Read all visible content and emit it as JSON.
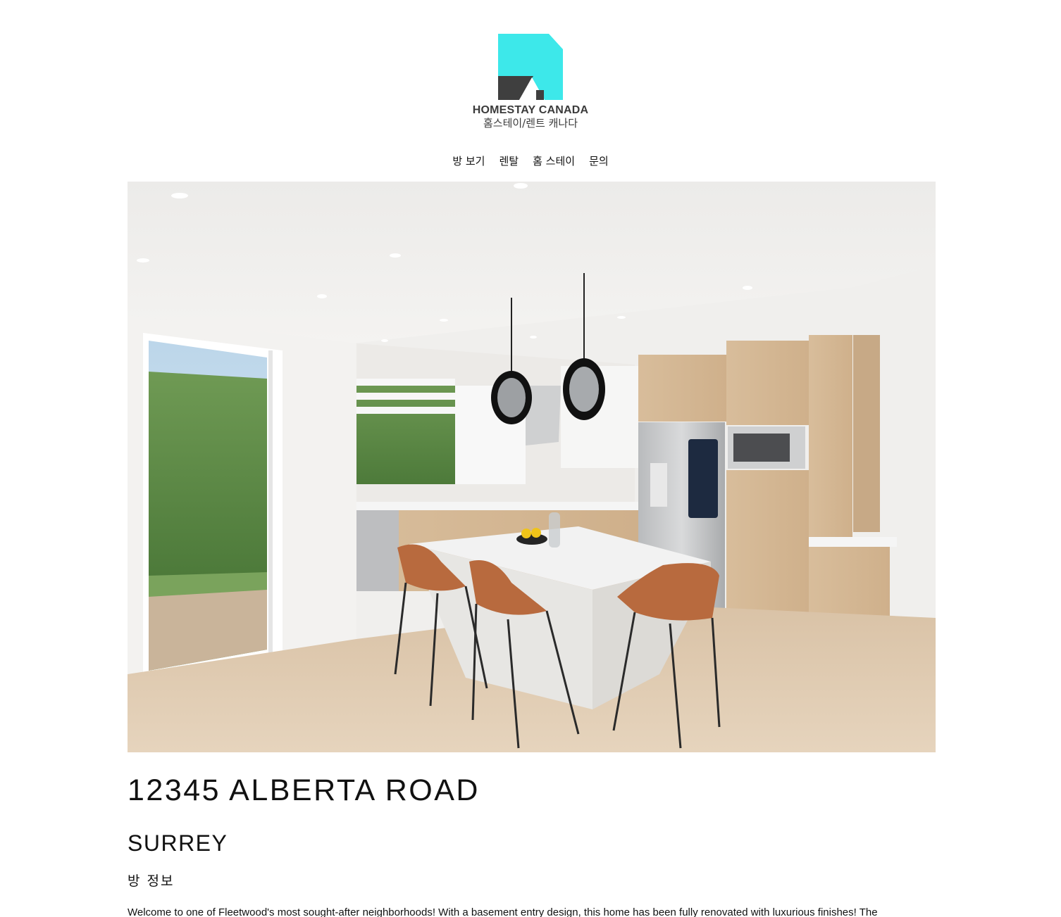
{
  "brand": {
    "name": "HOMESTAY CANADA",
    "subtitle": "홈스테이/렌트 캐나다",
    "logo_colors": {
      "primary": "#3de8ea",
      "secondary": "#3f3f3f"
    }
  },
  "nav": {
    "items": [
      {
        "label": "방 보기"
      },
      {
        "label": "렌탈"
      },
      {
        "label": "홈 스테이"
      },
      {
        "label": "문의"
      }
    ]
  },
  "hero": {
    "alt": "kitchen-photo"
  },
  "listing": {
    "address": "12345 ALBERTA ROAD",
    "city": "SURREY",
    "section_title": "방 정보",
    "description": "Welcome to one of Fleetwood's most sought-after neighborhoods! With a basement entry design, this home has been fully renovated with luxurious finishes! The"
  }
}
